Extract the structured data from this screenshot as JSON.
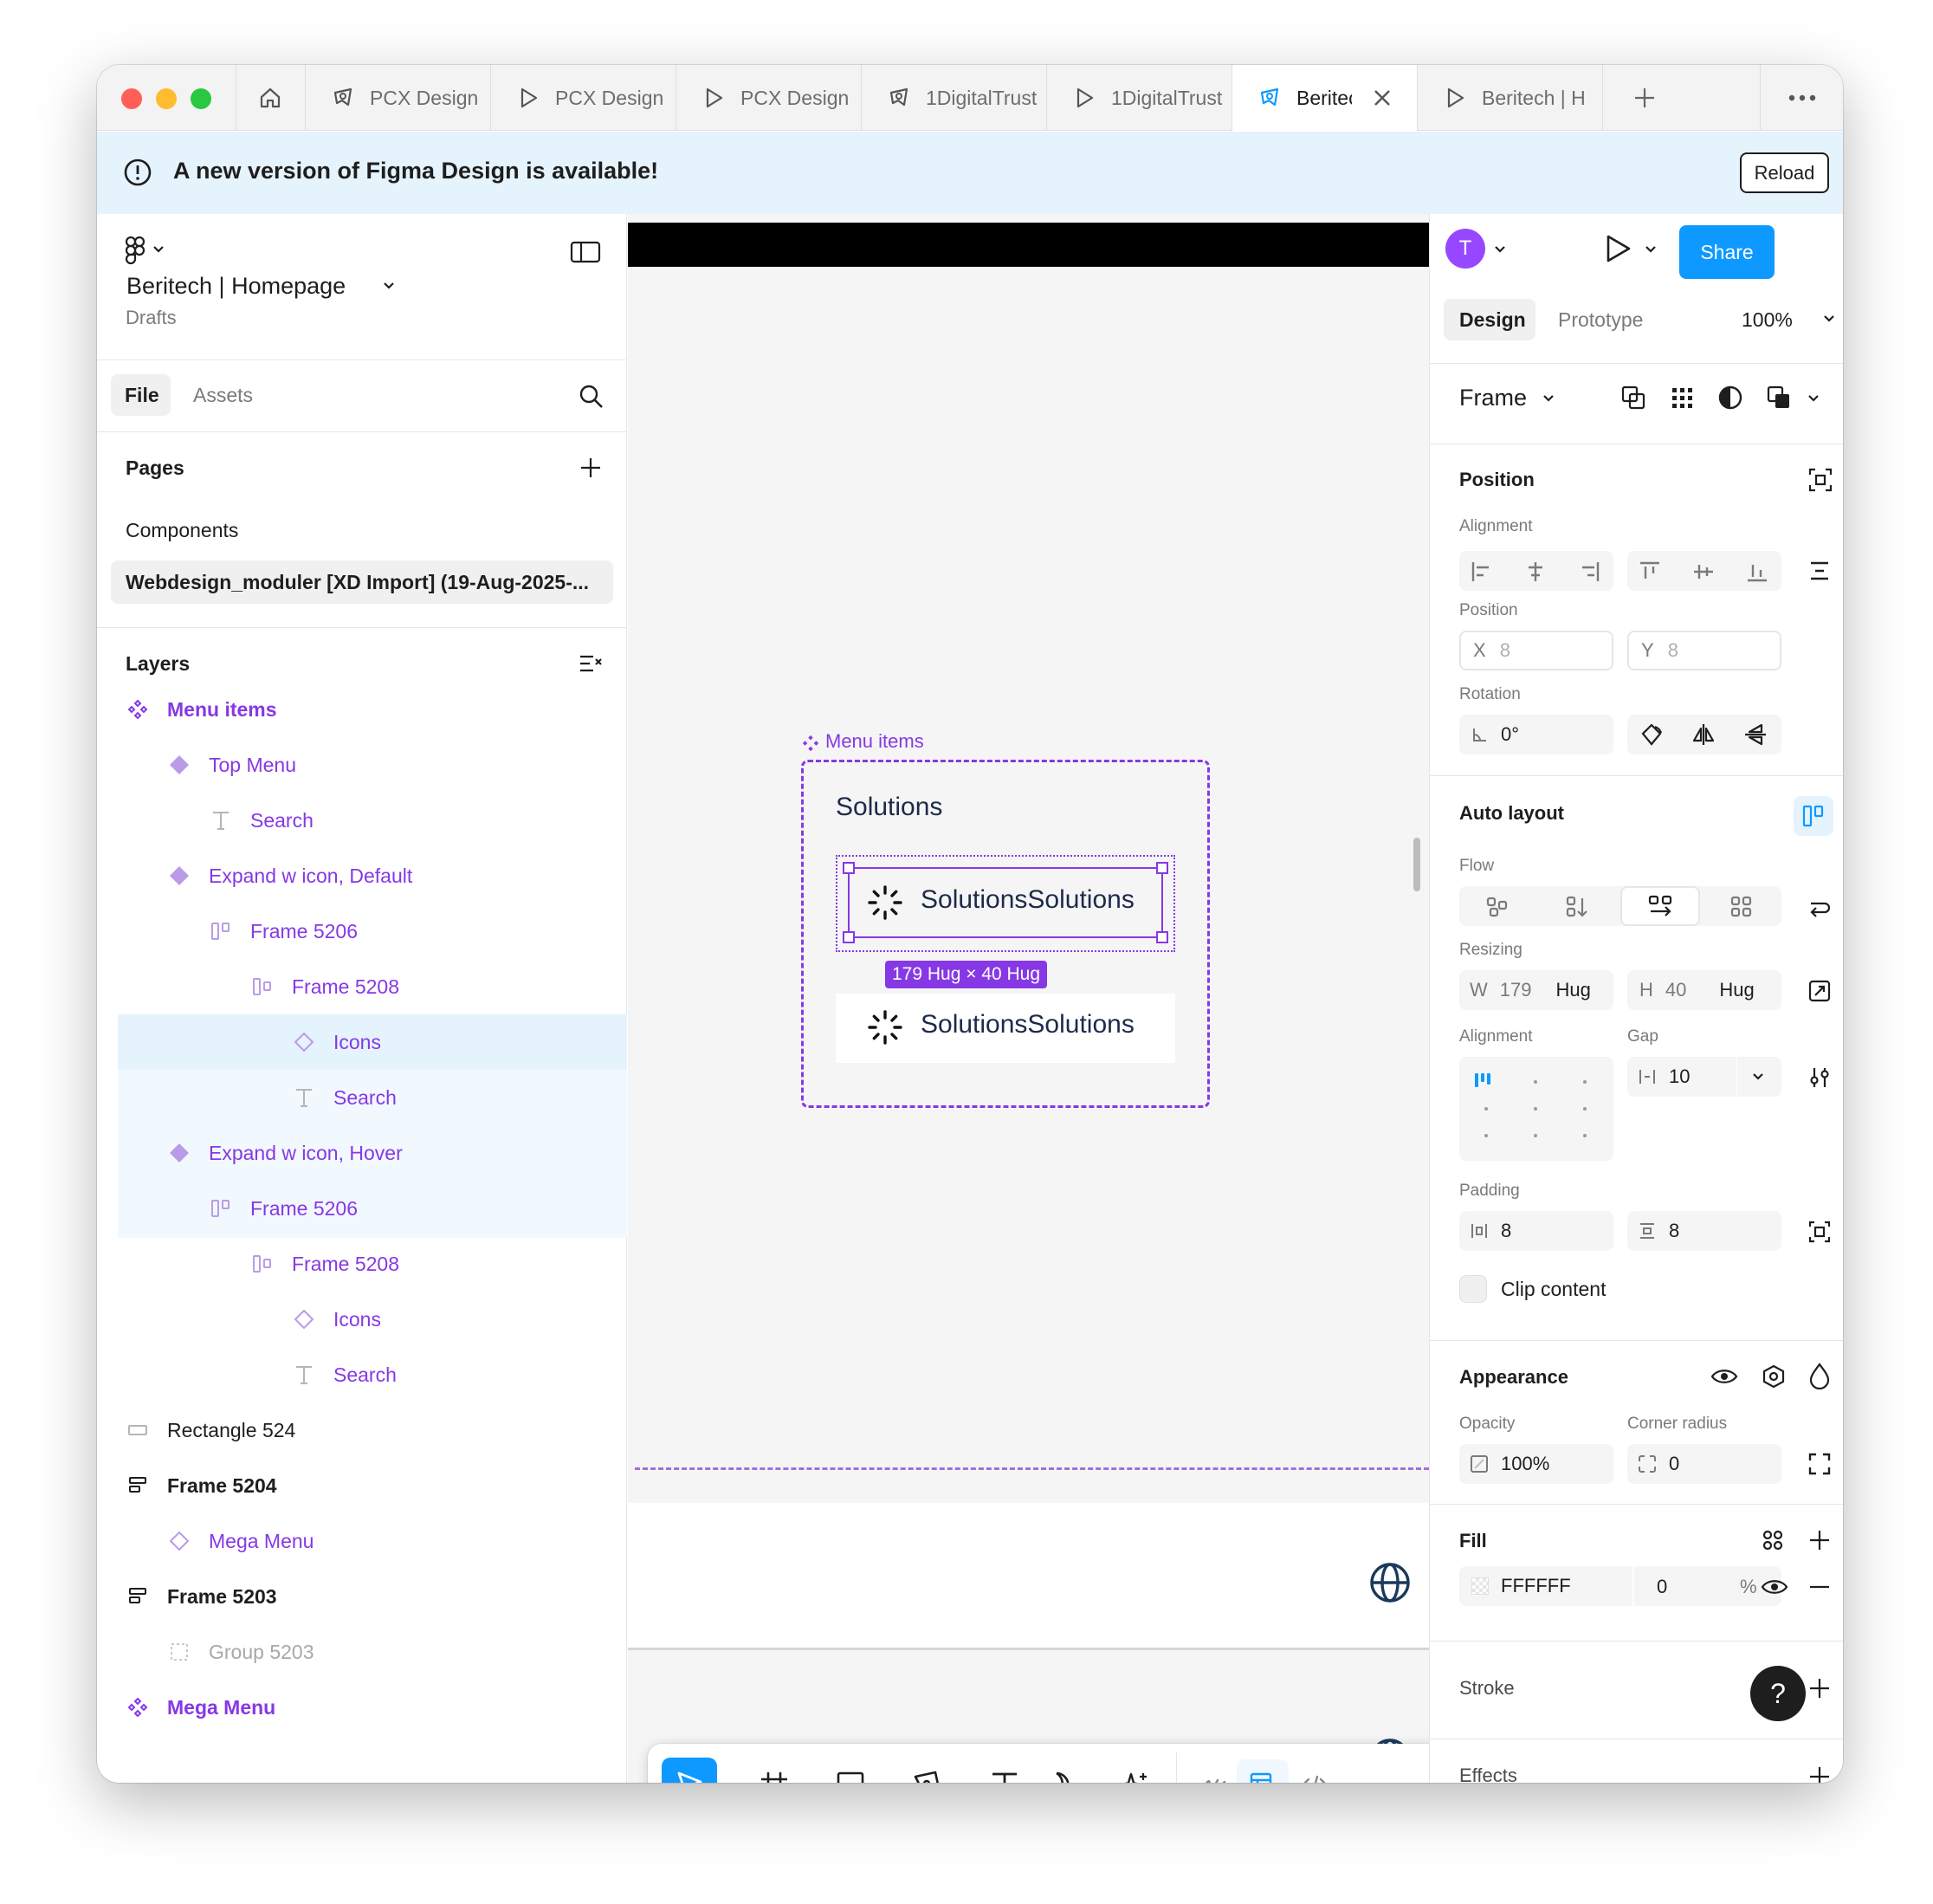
{
  "tabs": [
    {
      "label": "PCX Design",
      "icon": "figma-file-icon"
    },
    {
      "label": "PCX Design",
      "icon": "play-icon"
    },
    {
      "label": "PCX Design",
      "icon": "play-icon"
    },
    {
      "label": "1DigitalTrust",
      "icon": "figma-file-icon"
    },
    {
      "label": "1DigitalTrust",
      "icon": "play-icon"
    },
    {
      "label": "Beritech",
      "icon": "figma-file-icon",
      "active": true
    },
    {
      "label": "Beritech | H",
      "icon": "play-icon"
    }
  ],
  "banner": {
    "message": "A new version of Figma Design is available!",
    "reload_label": "Reload"
  },
  "file": {
    "name": "Beritech | Homepage",
    "location": "Drafts"
  },
  "left_tabs": {
    "file": "File",
    "assets": "Assets"
  },
  "pages": {
    "heading": "Pages",
    "items": [
      "Components",
      "Webdesign_moduler  [XD Import] (19-Aug-2025-..."
    ]
  },
  "layers": {
    "heading": "Layers",
    "items": [
      {
        "label": "Menu items",
        "type": "component-set"
      },
      {
        "label": "Top Menu",
        "type": "component"
      },
      {
        "label": "Search",
        "type": "text"
      },
      {
        "label": "Expand w icon, Default",
        "type": "component"
      },
      {
        "label": "Frame 5206",
        "type": "auto-frame"
      },
      {
        "label": "Frame 5208",
        "type": "auto-frame"
      },
      {
        "label": "Icons",
        "type": "instance"
      },
      {
        "label": "Search",
        "type": "text"
      },
      {
        "label": "Expand w icon, Hover",
        "type": "component"
      },
      {
        "label": "Frame 5206",
        "type": "auto-frame"
      },
      {
        "label": "Frame 5208",
        "type": "auto-frame"
      },
      {
        "label": "Icons",
        "type": "instance"
      },
      {
        "label": "Search",
        "type": "text"
      },
      {
        "label": "Rectangle 524",
        "type": "rectangle"
      },
      {
        "label": "Frame 5204",
        "type": "frame"
      },
      {
        "label": "Mega Menu",
        "type": "instance"
      },
      {
        "label": "Frame 5203",
        "type": "frame"
      },
      {
        "label": "Group 5203",
        "type": "group"
      },
      {
        "label": "Mega Menu",
        "type": "component-set"
      }
    ]
  },
  "canvas": {
    "component_label": "Menu items",
    "heading": "Solutions",
    "item1_label": "SolutionsSolutions",
    "item2_label": "SolutionsSolutions",
    "size_badge": "179 Hug × 40 Hug"
  },
  "right": {
    "avatar_letter": "T",
    "share_label": "Share",
    "tab_design": "Design",
    "tab_prototype": "Prototype",
    "zoom": "100%",
    "frame_label": "Frame",
    "position": {
      "heading": "Position",
      "alignment_label": "Alignment",
      "position_label": "Position",
      "x_label": "X",
      "x": "8",
      "y_label": "Y",
      "y": "8",
      "rotation_label": "Rotation",
      "rotation": "0°"
    },
    "auto_layout": {
      "heading": "Auto layout",
      "flow_label": "Flow",
      "resizing_label": "Resizing",
      "w_label": "W",
      "w": "179",
      "w_mode": "Hug",
      "h_label": "H",
      "h": "40",
      "h_mode": "Hug",
      "alignment_label": "Alignment",
      "gap_label": "Gap",
      "gap": "10",
      "padding_label": "Padding",
      "padding_h": "8",
      "padding_v": "8",
      "clip_label": "Clip content"
    },
    "appearance": {
      "heading": "Appearance",
      "opacity_label": "Opacity",
      "opacity": "100%",
      "radius_label": "Corner radius",
      "radius": "0"
    },
    "fill": {
      "heading": "Fill",
      "hex": "FFFFFF",
      "opacity": "0",
      "unit": "%"
    },
    "stroke": {
      "heading": "Stroke"
    },
    "effects": {
      "heading": "Effects"
    }
  },
  "colors": {
    "accent": "#0d99ff",
    "component": "#8638e5",
    "selection_bg": "#e5f3fd",
    "banner_bg": "#e5f3fd"
  }
}
